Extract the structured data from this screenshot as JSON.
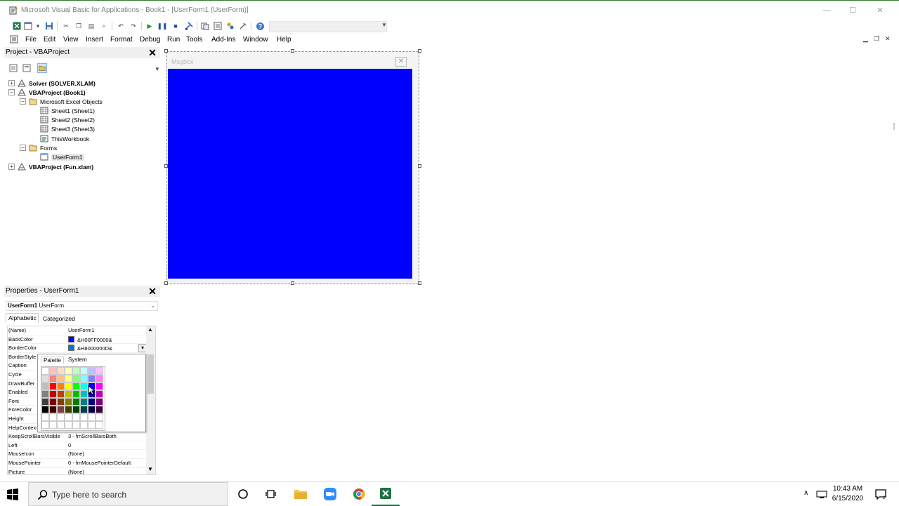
{
  "window": {
    "title": "Microsoft Visual Basic for Applications - Book1 - [UserForm1 (UserForm)]",
    "minimize": "—",
    "maximize": "☐",
    "close": "✕"
  },
  "menu": [
    "File",
    "Edit",
    "View",
    "Insert",
    "Format",
    "Debug",
    "Run",
    "Tools",
    "Add-Ins",
    "Window",
    "Help"
  ],
  "project_panel": {
    "title": "Project - VBAProject",
    "tree": [
      {
        "label": "Solver (SOLVER.XLAM)",
        "bold": true,
        "expander": "+"
      },
      {
        "label": "VBAProject (Book1)",
        "bold": true,
        "expander": "−"
      },
      {
        "label": "Microsoft Excel Objects",
        "bold": false,
        "expander": "−"
      },
      {
        "label": "Sheet1 (Sheet1)",
        "bold": false,
        "expander": ""
      },
      {
        "label": "Sheet2 (Sheet2)",
        "bold": false,
        "expander": ""
      },
      {
        "label": "Sheet3 (Sheet3)",
        "bold": false,
        "expander": ""
      },
      {
        "label": "ThisWorkbook",
        "bold": false,
        "expander": ""
      },
      {
        "label": "Forms",
        "bold": false,
        "expander": "−"
      },
      {
        "label": "UserForm1",
        "bold": false,
        "expander": "",
        "selected": true
      },
      {
        "label": "VBAProject (Fun.xlam)",
        "bold": true,
        "expander": "+"
      }
    ]
  },
  "properties_panel": {
    "title": "Properties - UserForm1",
    "object_name": "UserForm1",
    "object_type": "UserForm",
    "tabs": [
      "Alphabetic",
      "Categorized"
    ],
    "rows": [
      {
        "name": "(Name)",
        "value": "UserForm1"
      },
      {
        "name": "BackColor",
        "value": "&H00FF0000&",
        "swatch": "#0000ff"
      },
      {
        "name": "BorderColor",
        "value": "&H8000000D&",
        "swatch": "#0078d7"
      },
      {
        "name": "BorderStyle",
        "value": ""
      },
      {
        "name": "Caption",
        "value": ""
      },
      {
        "name": "Cycle",
        "value": ""
      },
      {
        "name": "DrawBuffer",
        "value": ""
      },
      {
        "name": "Enabled",
        "value": ""
      },
      {
        "name": "Font",
        "value": ""
      },
      {
        "name": "ForeColor",
        "value": ""
      },
      {
        "name": "Height",
        "value": ""
      },
      {
        "name": "HelpContextID",
        "value": ""
      },
      {
        "name": "KeepScrollBarsVisible",
        "value": "3 - fmScrollBarsBoth"
      },
      {
        "name": "Left",
        "value": "0"
      },
      {
        "name": "MouseIcon",
        "value": "(None)"
      },
      {
        "name": "MousePointer",
        "value": "0 - fmMousePointerDefault"
      },
      {
        "name": "Picture",
        "value": "(None)"
      }
    ],
    "palette_tabs": [
      "Palette",
      "System"
    ]
  },
  "userform": {
    "caption": "Msgbox",
    "close": "✕",
    "back_color": "#0000ff"
  },
  "palette": [
    [
      "#ffffff",
      "#ffc0c0",
      "#ffe0c0",
      "#ffffc0",
      "#c0ffc0",
      "#c0ffff",
      "#c0c0ff",
      "#ffc0ff"
    ],
    [
      "#e0e0e0",
      "#ff8080",
      "#ffc080",
      "#ffff80",
      "#80ff80",
      "#80ffff",
      "#8080ff",
      "#ff80ff"
    ],
    [
      "#c0c0c0",
      "#ff0000",
      "#ff8000",
      "#ffff00",
      "#00ff00",
      "#00ffff",
      "#0000ff",
      "#ff00ff"
    ],
    [
      "#808080",
      "#c00000",
      "#c04000",
      "#c0c000",
      "#00c000",
      "#00c0c0",
      "#0000c0",
      "#c000c0"
    ],
    [
      "#404040",
      "#800000",
      "#804000",
      "#808000",
      "#008000",
      "#008080",
      "#000080",
      "#800080"
    ],
    [
      "#000000",
      "#400000",
      "#804040",
      "#404000",
      "#004000",
      "#004040",
      "#000040",
      "#400040"
    ],
    [
      "#ffffff",
      "#ffffff",
      "#ffffff",
      "#ffffff",
      "#ffffff",
      "#ffffff",
      "#ffffff",
      "#ffffff"
    ],
    [
      "#ffffff",
      "#ffffff",
      "#ffffff",
      "#ffffff",
      "#ffffff",
      "#ffffff",
      "#ffffff",
      "#ffffff"
    ]
  ],
  "taskbar": {
    "search_placeholder": "Type here to search",
    "time": "10:43 AM",
    "date": "6/15/2020"
  }
}
